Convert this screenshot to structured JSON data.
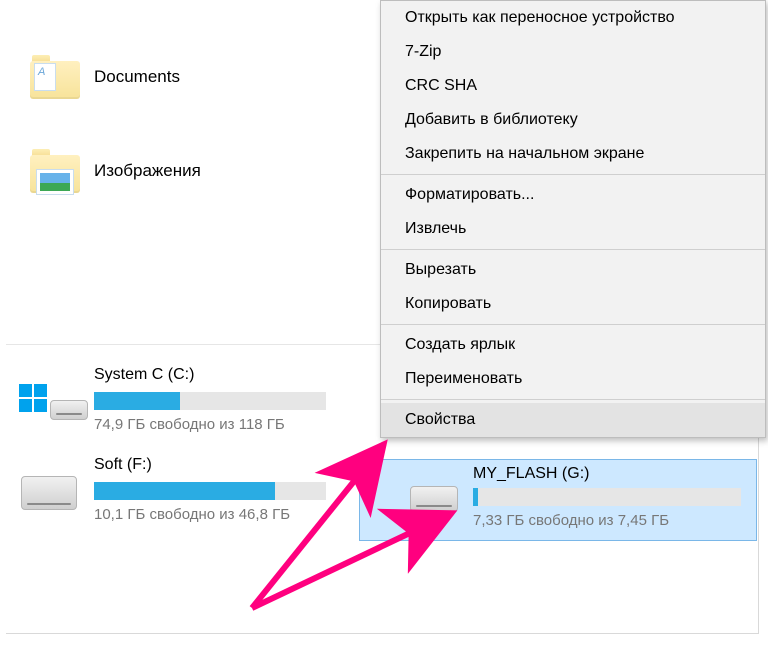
{
  "folders": [
    {
      "label": "Documents"
    },
    {
      "label": "Изображения"
    }
  ],
  "drives": {
    "c": {
      "title": "System C (C:)",
      "sub": "74,9 ГБ свободно из 118 ГБ",
      "fill_pct": 37
    },
    "f": {
      "title": "Soft (F:)",
      "sub": "10,1 ГБ свободно из 46,8 ГБ",
      "fill_pct": 78
    },
    "g": {
      "title": "MY_FLASH (G:)",
      "sub": "7,33 ГБ свободно из 7,45 ГБ",
      "fill_pct": 2
    }
  },
  "context_menu": {
    "items": [
      "Открыть как переносное устройство",
      "7-Zip",
      "CRC SHA",
      "Добавить в библиотеку",
      "Закрепить на начальном экране"
    ],
    "group2": [
      "Форматировать...",
      "Извлечь"
    ],
    "group3": [
      "Вырезать",
      "Копировать"
    ],
    "group4": [
      "Создать ярлык",
      "Переименовать"
    ],
    "group5": [
      "Свойства"
    ]
  }
}
